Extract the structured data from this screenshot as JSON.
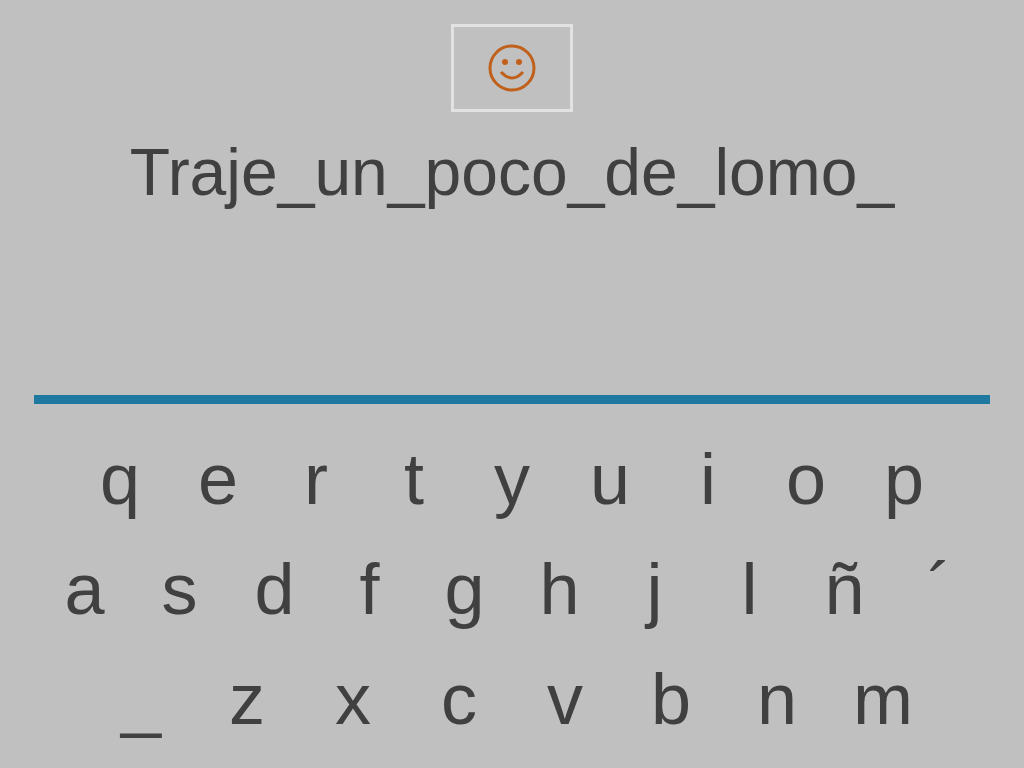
{
  "title": "Traje_un_poco_de_lomo_",
  "keyboard": {
    "rows": [
      {
        "keys": [
          "q",
          "e",
          "r",
          "t",
          "y",
          "u",
          "i",
          "o",
          "p"
        ]
      },
      {
        "keys": [
          "a",
          "s",
          "d",
          "f",
          "g",
          "h",
          "j",
          "l",
          "ñ",
          "´"
        ]
      },
      {
        "keys": [
          "_",
          "z",
          "x",
          "c",
          "v",
          "b",
          "n",
          "m"
        ]
      }
    ]
  }
}
